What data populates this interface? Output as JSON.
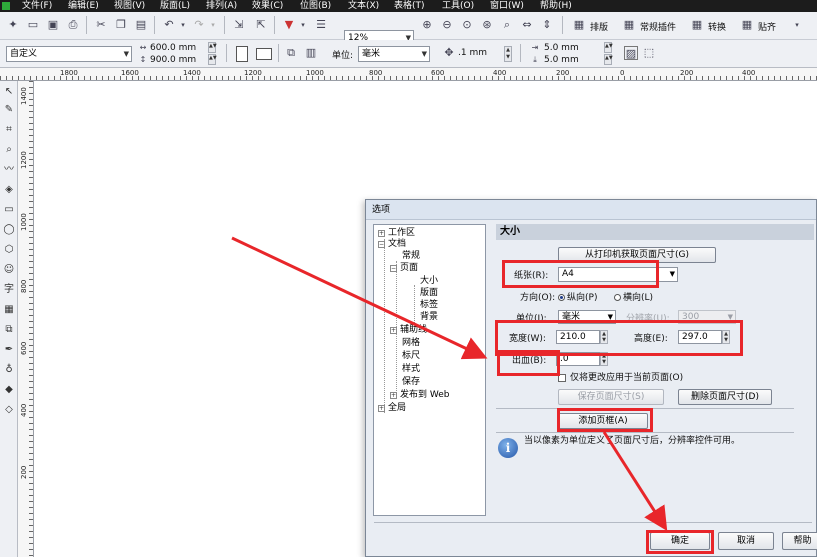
{
  "menu": {
    "items": [
      "文件(F)",
      "编辑(E)",
      "视图(V)",
      "版面(L)",
      "排列(A)",
      "效果(C)",
      "位图(B)",
      "文本(X)",
      "表格(T)",
      "工具(O)",
      "窗口(W)",
      "帮助(H)"
    ]
  },
  "toolbar1": {
    "zoom": "12%",
    "layout_label": "排版",
    "plugin_label": "常规插件",
    "convert_label": "转换",
    "snap_label": "贴齐"
  },
  "toolbar2": {
    "page_preset": "自定义",
    "page_width": "600.0 mm",
    "page_height": "900.0 mm",
    "unit_label": "单位:",
    "unit_value": "毫米",
    "nudge": ".1 mm",
    "dup_x": "5.0 mm",
    "dup_y": "5.0 mm"
  },
  "ruler": {
    "h_labels": [
      "1800",
      "1600",
      "1400",
      "1200",
      "1000",
      "800",
      "600",
      "400",
      "200",
      "0",
      "200",
      "400"
    ],
    "v_labels": [
      "1400",
      "1200",
      "1000",
      "800",
      "600",
      "400",
      "200"
    ]
  },
  "dialog": {
    "title": "选项",
    "tree": {
      "workspace": "工作区",
      "document": "文档",
      "general": "常规",
      "page": "页面",
      "size": "大小",
      "layout": "版面",
      "label": "标签",
      "background": "背景",
      "guides": "辅助线",
      "grid": "网格",
      "rulers": "标尺",
      "styles": "样式",
      "save": "保存",
      "publish_web": "发布到 Web",
      "global": "全局"
    },
    "panel_title": "大小",
    "from_printer_button": "从打印机获取页面尺寸(G)",
    "paper_label": "纸张(R):",
    "paper_value": "A4",
    "orientation_label": "方向(O):",
    "portrait_label": "纵向(P)",
    "landscape_label": "横向(L)",
    "unit_label": "单位(I):",
    "unit_value": "毫米",
    "resolution_label": "分辨率(U):",
    "resolution_value": "300",
    "width_label": "宽度(W):",
    "width_value": "210.0",
    "height_label": "高度(E):",
    "height_value": "297.0",
    "bleed_label": "出血(B):",
    "bleed_value": ".0",
    "apply_current_only": "仅将更改应用于当前页面(O)",
    "save_page_size_button": "保存页面尺寸(S)",
    "delete_page_size_button": "删除页面尺寸(D)",
    "add_page_frame_button": "添加页框(A)",
    "info_text": "当以像素为单位定义了页面尺寸后，分辨率控件可用。",
    "ok_button": "确定",
    "cancel_button": "取消",
    "help_button": "帮助"
  },
  "colors": {
    "annotation": "#e8262a",
    "menubar": "#1c1c1c",
    "dialog_bg": "#e9edf3"
  }
}
